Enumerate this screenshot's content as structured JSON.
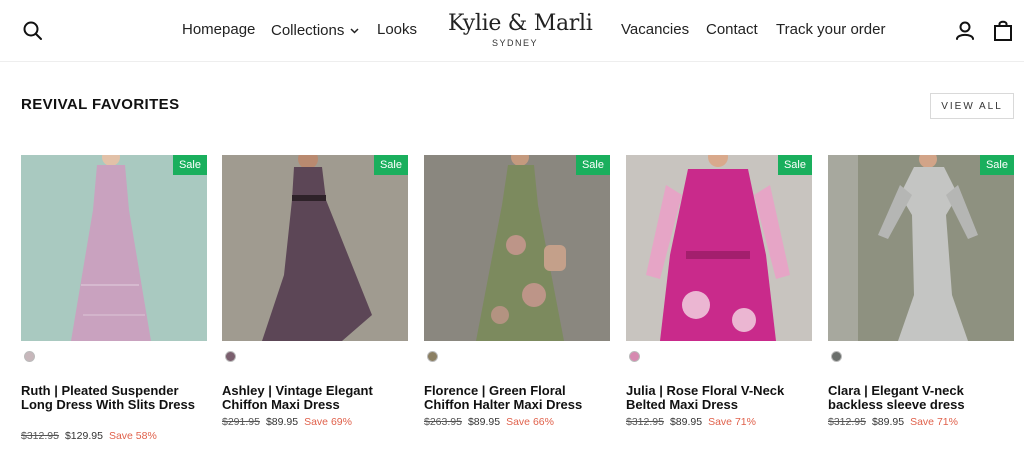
{
  "header": {
    "nav_left": [
      "Homepage",
      "Collections",
      "Looks"
    ],
    "nav_right": [
      "Vacancies",
      "Contact",
      "Track your order"
    ],
    "logo": {
      "name": "Kylie & Marli",
      "sub": "SYDNEY"
    }
  },
  "section": {
    "title": "REVIVAL FAVORITES",
    "view_all": "VIEW ALL"
  },
  "products": [
    {
      "title": "Ruth | Pleated Suspender Long Dress With Slits Dress",
      "old_price": "$312.95",
      "price": "$129.95",
      "save": "Save 58%",
      "badge": "Sale",
      "bg": "#a9c9c0",
      "dress": "#c9a2bf",
      "swatch": "#c7b7bb"
    },
    {
      "title": "Ashley | Vintage Elegant Chiffon Maxi Dress",
      "old_price": "$291.95",
      "price": "$89.95",
      "save": "Save 69%",
      "badge": "Sale",
      "bg": "#a09b90",
      "dress": "#5c4656",
      "swatch": "#7a5f6e"
    },
    {
      "title": "Florence | Green Floral Chiffon Halter Maxi Dress",
      "old_price": "$263.95",
      "price": "$89.95",
      "save": "Save 66%",
      "badge": "Sale",
      "bg": "#8a877f",
      "dress": "#7c8a5e",
      "swatch": "#8b7f62"
    },
    {
      "title": "Julia | Rose Floral V-Neck Belted Maxi Dress",
      "old_price": "$312.95",
      "price": "$89.95",
      "save": "Save 71%",
      "badge": "Sale",
      "bg": "#c8c4bf",
      "dress": "#c92a8b",
      "swatch": "#d68ab0"
    },
    {
      "title": "Clara | Elegant V-neck backless sleeve dress",
      "old_price": "$312.95",
      "price": "$89.95",
      "save": "Save 71%",
      "badge": "Sale",
      "bg": "#8e9180",
      "dress": "#c4c5c3",
      "swatch": "#6b6f6c"
    }
  ]
}
